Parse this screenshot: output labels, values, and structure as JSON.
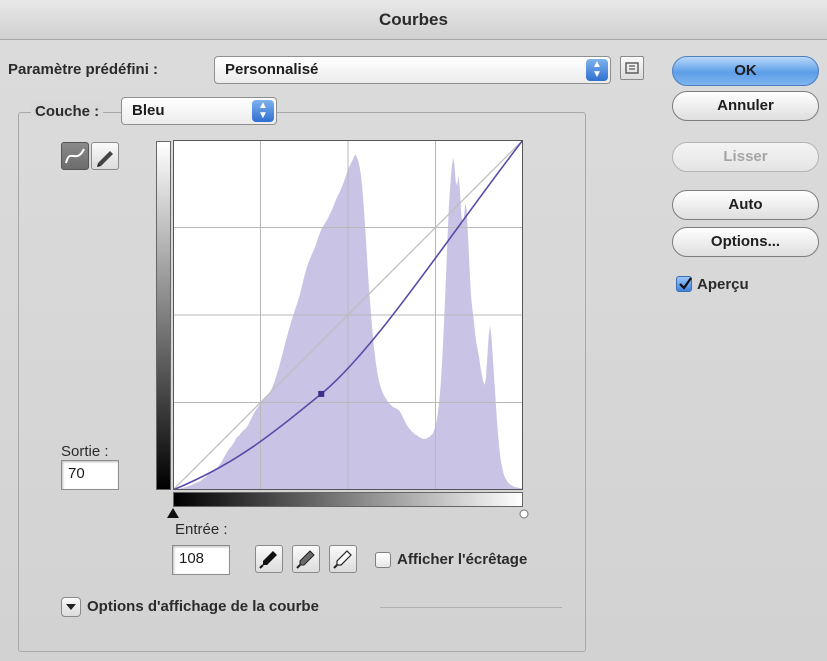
{
  "window": {
    "title": "Courbes"
  },
  "preset": {
    "label": "Paramètre prédéfini :",
    "value": "Personnalisé",
    "menu_icon": "preset-options-icon"
  },
  "channel": {
    "label": "Couche :",
    "value": "Bleu"
  },
  "tools": {
    "curve_tool_icon": "curve-point-icon",
    "pencil_tool_icon": "pencil-icon"
  },
  "output": {
    "label": "Sortie :",
    "value": "70"
  },
  "input": {
    "label": "Entrée :",
    "value": "108"
  },
  "eyedroppers": [
    "black-eyedropper-icon",
    "gray-eyedropper-icon",
    "white-eyedropper-icon"
  ],
  "clipping": {
    "label": "Afficher l'écrêtage",
    "checked": false
  },
  "curve_display": {
    "label": "Options d'affichage de la courbe",
    "expanded": false
  },
  "buttons": {
    "ok": "OK",
    "cancel": "Annuler",
    "smooth": "Lisser",
    "auto": "Auto",
    "options": "Options..."
  },
  "preview": {
    "label": "Aperçu",
    "checked": true
  },
  "colors": {
    "curve": "#5a4aa8",
    "histogram": "#c9c4e6",
    "grid": "#b9b9b9",
    "accent": "#4a8de0"
  },
  "curve": {
    "control_points": [
      [
        0,
        0
      ],
      [
        108,
        70
      ],
      [
        255,
        255
      ]
    ],
    "selected_point": {
      "input": 108,
      "output": 70
    }
  },
  "histogram": [
    0,
    1,
    2,
    2,
    3,
    4,
    5,
    6,
    7,
    8,
    9,
    11,
    12,
    14,
    15,
    17,
    19,
    21,
    22,
    24,
    26,
    29,
    32,
    35,
    38,
    42,
    46,
    49,
    51,
    54,
    57,
    60,
    63,
    67,
    72,
    78,
    85,
    92,
    99,
    106,
    112,
    118,
    122,
    127,
    133,
    140,
    148,
    152,
    155,
    160,
    165,
    170,
    172,
    176,
    181,
    188,
    196,
    204,
    212,
    220,
    226,
    232,
    238,
    244,
    248,
    253,
    258,
    262,
    266,
    270,
    276,
    282,
    290,
    300,
    310,
    322,
    335,
    348,
    362,
    378,
    392,
    408,
    424,
    438,
    452,
    466,
    480,
    492,
    504,
    516,
    528,
    540,
    552,
    568,
    584,
    600,
    615,
    630,
    642,
    652,
    662,
    672,
    680,
    690,
    700,
    712,
    724,
    734,
    744,
    752,
    758,
    764,
    770,
    778,
    786,
    794,
    802,
    812,
    822,
    832,
    840,
    848,
    856,
    866,
    876,
    886,
    898,
    910,
    920,
    928,
    936,
    944,
    954,
    958,
    950,
    940,
    922,
    898,
    858,
    810,
    752,
    688,
    624,
    566,
    516,
    468,
    424,
    388,
    358,
    332,
    312,
    298,
    286,
    276,
    268,
    262,
    256,
    250,
    246,
    242,
    238,
    236,
    234,
    232,
    230,
    226,
    220,
    212,
    204,
    196,
    188,
    182,
    176,
    172,
    168,
    164,
    160,
    158,
    156,
    152,
    150,
    148,
    146,
    146,
    146,
    148,
    150,
    152,
    156,
    160,
    168,
    180,
    196,
    220,
    256,
    300,
    362,
    440,
    528,
    620,
    720,
    810,
    870,
    920,
    950,
    930,
    880,
    870,
    900,
    860,
    790,
    760,
    780,
    820,
    800,
    720,
    640,
    560,
    520,
    490,
    450,
    420,
    400,
    380,
    350,
    330,
    310,
    300,
    320,
    380,
    440,
    470,
    440,
    380,
    320,
    260,
    200,
    150,
    110,
    80,
    60,
    45,
    35,
    28,
    22,
    18,
    15,
    12,
    10,
    9,
    8,
    7,
    6,
    5,
    5,
    4,
    4,
    3,
    3,
    3,
    2,
    2,
    2,
    1,
    1,
    1,
    1,
    1
  ]
}
